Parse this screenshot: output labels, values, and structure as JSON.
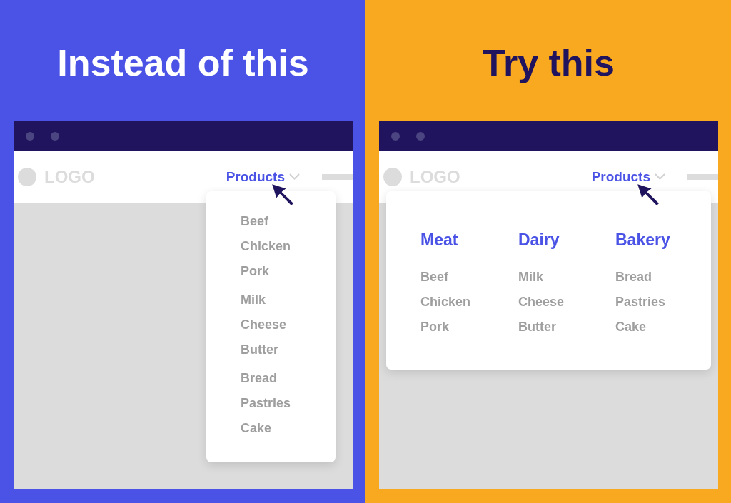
{
  "panels": [
    {
      "kind": "before",
      "title": "Instead of this",
      "browser": {
        "logo": "LOGO",
        "nav": {
          "label": "Products"
        },
        "menu": {
          "kind": "list",
          "groups": [
            {
              "items": [
                "Beef",
                "Chicken",
                "Pork"
              ]
            },
            {
              "items": [
                "Milk",
                "Cheese",
                "Butter"
              ]
            },
            {
              "items": [
                "Bread",
                "Pastries",
                "Cake"
              ]
            }
          ]
        }
      }
    },
    {
      "kind": "after",
      "title": "Try this",
      "browser": {
        "logo": "LOGO",
        "nav": {
          "label": "Products"
        },
        "menu": {
          "kind": "columns",
          "groups": [
            {
              "heading": "Meat",
              "items": [
                "Beef",
                "Chicken",
                "Pork"
              ]
            },
            {
              "heading": "Dairy",
              "items": [
                "Milk",
                "Cheese",
                "Butter"
              ]
            },
            {
              "heading": "Bakery",
              "items": [
                "Bread",
                "Pastries",
                "Cake"
              ]
            }
          ]
        }
      }
    }
  ]
}
